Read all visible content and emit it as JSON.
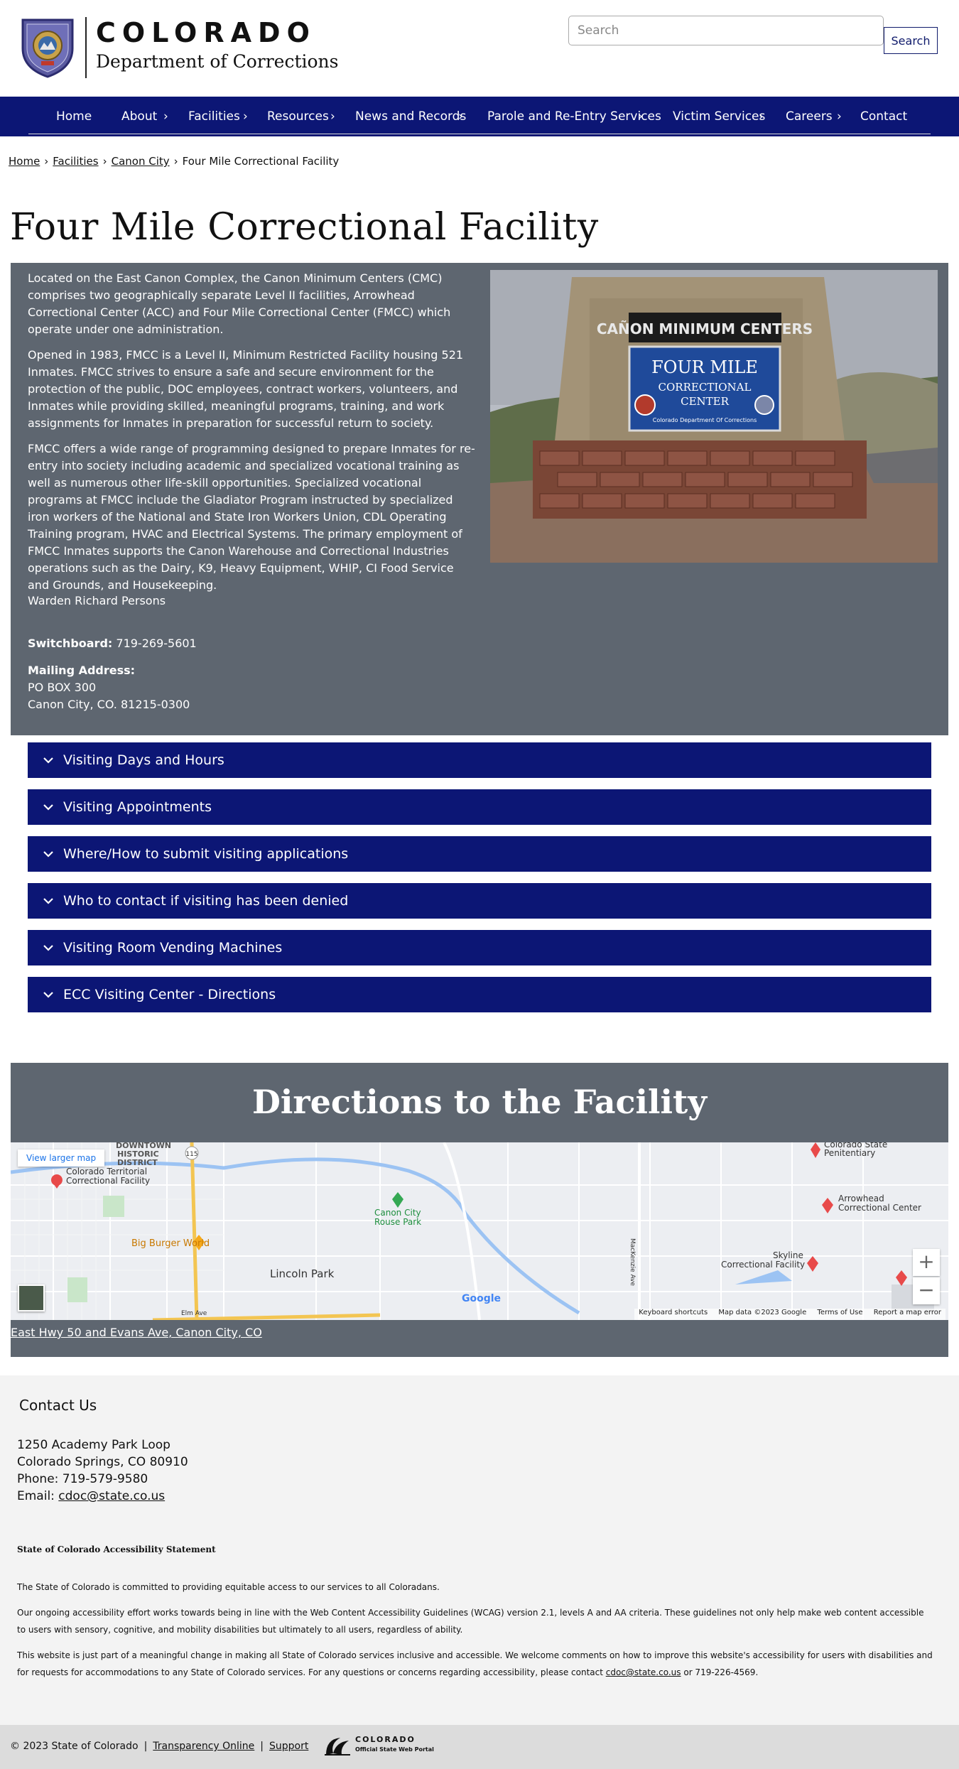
{
  "header": {
    "brand_line1": "COLORADO",
    "brand_line2": "Department of Corrections",
    "search_placeholder": "Search",
    "search_button": "Search"
  },
  "nav": {
    "items": [
      "Home",
      "About",
      "Facilities",
      "Resources",
      "News and Records",
      "Parole and Re-Entry Services",
      "Victim Services",
      "Careers",
      "Contact"
    ]
  },
  "breadcrumb": {
    "home": "Home",
    "facilities": "Facilities",
    "city": "Canon City",
    "current": "Four Mile Correctional Facility"
  },
  "page": {
    "title": "Four Mile Correctional Facility",
    "paragraphs": [
      "Located on the East Canon Complex, the Canon Minimum Centers (CMC) comprises two geographically separate Level II facilities, Arrowhead Correctional Center (ACC) and Four Mile Correctional Center (FMCC) which operate under one administration.",
      "Opened in 1983, FMCC is a Level II, Minimum Restricted Facility housing 521 Inmates. FMCC strives to ensure a safe and secure environment for the protection of the public, DOC employees, contract workers, volunteers, and Inmates while providing skilled, meaningful programs, training, and work assignments for Inmates in preparation for successful return to society.",
      "FMCC offers a wide range of programming designed to prepare Inmates for re-entry into society including academic and specialized vocational training as well as numerous other life-skill opportunities. Specialized vocational programs at FMCC include the Gladiator Program instructed by specialized iron workers of the National and State Iron Workers Union, CDL Operating Training program, HVAC and Electrical Systems. The primary employment of FMCC Inmates supports the Canon Warehouse and Correctional Industries operations such as the Dairy, K9, Heavy Equipment, WHIP, CI Food Service and Grounds, and Housekeeping."
    ],
    "warden": "Warden Richard Persons",
    "switchboard_label": "Switchboard:",
    "switchboard_value": "719-269-5601",
    "mailing_label": "Mailing Address:",
    "mailing_line1": "PO BOX 300",
    "mailing_line2": "Canon City, CO. 81215-0300",
    "photo": {
      "sign_top": "CAÑON MINIMUM CENTERS",
      "sign_main": "FOUR MILE",
      "sign_line2": "CORRECTIONAL",
      "sign_line3": "CENTER",
      "sign_small": "Colorado Department Of Corrections"
    }
  },
  "accordions": [
    "Visiting Days and Hours",
    "Visiting Appointments",
    "Where/How to submit visiting applications",
    "Who to contact if visiting has been denied",
    "Visiting Room Vending Machines",
    "ECC Visiting Center - Directions"
  ],
  "directions": {
    "title": "Directions to the Facility",
    "view_larger": "View larger map",
    "address_link": "East Hwy 50 and Evans Ave, Canon City, CO",
    "map_labels": {
      "downtown": "DOWNTOWN",
      "historic": "HISTORIC",
      "district": "DISTRICT",
      "territorial1": "Colorado Territorial",
      "territorial2": "Correctional Facility",
      "big_burger": "Big Burger World",
      "rouse1": "Canon City",
      "rouse2": "Rouse Park",
      "lincoln": "Lincoln Park",
      "penitentiary1": "Colorado State",
      "penitentiary2": "Penitentiary",
      "arrowhead1": "Arrowhead",
      "arrowhead2": "Correctional Center",
      "skyline1": "Skyline",
      "skyline2": "Correctional Facility",
      "google": "Google",
      "road_115": "115",
      "elm": "Elm Ave",
      "mackenzie": "MacKenzie Ave"
    },
    "map_footer": [
      "Keyboard shortcuts",
      "Map data ©2023 Google",
      "Terms of Use",
      "Report a map error"
    ]
  },
  "footer": {
    "contact_title": "Contact Us",
    "address1": "1250 Academy Park Loop",
    "address2": "Colorado Springs, CO 80910",
    "phone": "Phone: 719-579-9580",
    "email_label": "Email: ",
    "email": "cdoc@state.co.us",
    "a11y_title": "State of Colorado Accessibility Statement",
    "a11y_p1": "The State of Colorado is committed to providing equitable access to our services to all Coloradans.",
    "a11y_p2": "Our ongoing accessibility effort works towards being in line with the Web Content Accessibility Guidelines (WCAG) version 2.1, levels A and AA criteria. These guidelines not only help make web content accessible to users with sensory, cognitive, and mobility disabilities but ultimately to all users, regardless of ability.",
    "a11y_p3_start": "This website is just part of a meaningful change in making all State of Colorado services inclusive and accessible. We welcome comments on how to improve this website's accessibility for users with disabilities and for requests for accommodations to any State of Colorado services. For any questions or concerns regarding accessibility, please contact ",
    "a11y_p3_email": "cdoc@state.co.us",
    "a11y_p3_end": " or 719-226-4569.",
    "copyright": "© 2023 State of Colorado",
    "transparency": "Transparency Online",
    "support": "Support",
    "portal_name": "COLORADO",
    "portal_sub": "Official State Web Portal"
  },
  "colors": {
    "navy": "#0c1675",
    "slate_panel": "#5e6670",
    "footer_bg": "#f3f3f3"
  }
}
